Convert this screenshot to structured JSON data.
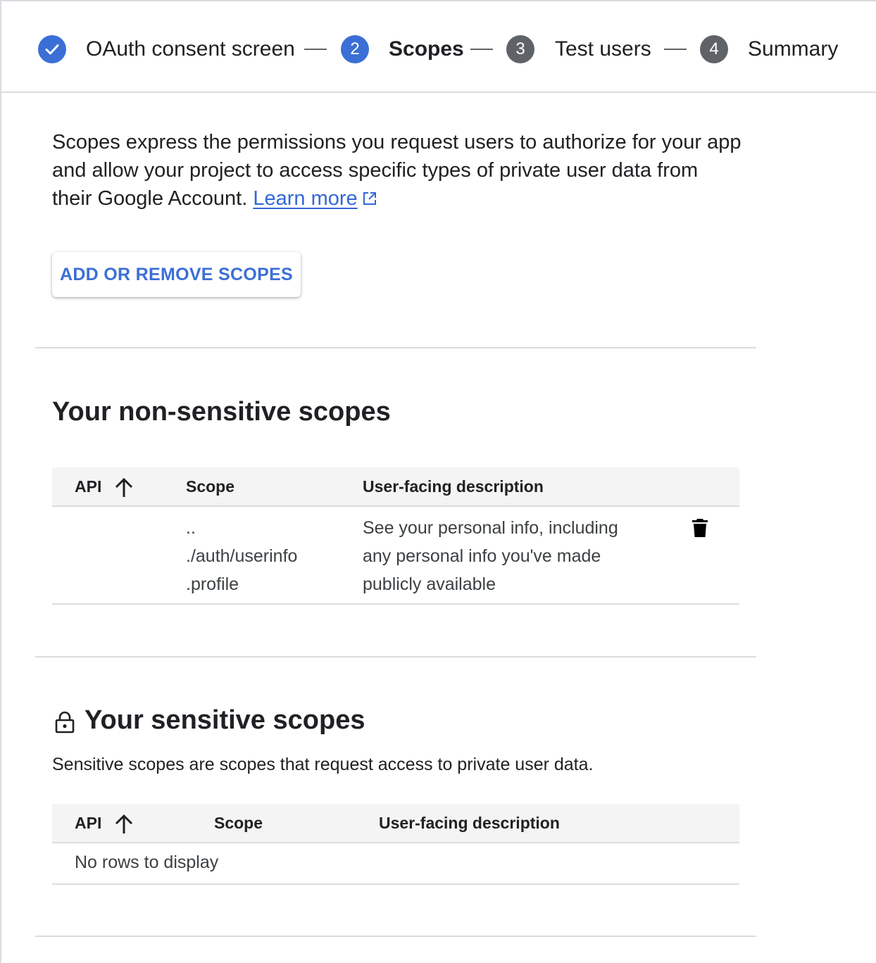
{
  "stepper": {
    "steps": [
      {
        "label": "OAuth consent screen",
        "state": "completed",
        "icon": "check-icon"
      },
      {
        "label": "Scopes",
        "number": "2",
        "state": "active"
      },
      {
        "label": "Test users",
        "number": "3",
        "state": "pending"
      },
      {
        "label": "Summary",
        "number": "4",
        "state": "pending"
      }
    ]
  },
  "intro": {
    "text": "Scopes express the permissions you request users to authorize for your app and allow your project to access specific types of private user data from their Google Account.",
    "link_label": "Learn more",
    "link_icon": "external-link-icon"
  },
  "add_scopes_button": "ADD OR REMOVE SCOPES",
  "non_sensitive": {
    "title": "Your non-sensitive scopes",
    "columns": [
      "API",
      "Scope",
      "User-facing description"
    ],
    "sort_icon": "arrow-up-icon",
    "rows": [
      {
        "api": "",
        "scope_lines": [
          "..",
          "./auth/userinfo",
          ".profile"
        ],
        "description_lines": [
          "See your personal info, including",
          "any personal info you've made",
          "publicly available"
        ],
        "action_icon": "trash-icon"
      }
    ]
  },
  "sensitive": {
    "title": "Your sensitive scopes",
    "title_icon": "lock-icon",
    "subtitle": "Sensitive scopes are scopes that request access to private user data.",
    "columns": [
      "API",
      "Scope",
      "User-facing description"
    ],
    "sort_icon": "arrow-up-icon",
    "empty_text": "No rows to display"
  },
  "colors": {
    "accent": "#3b6fd6",
    "pending_step": "#5f6368",
    "divider": "#dadce0",
    "table_header_bg": "#f4f4f4"
  }
}
